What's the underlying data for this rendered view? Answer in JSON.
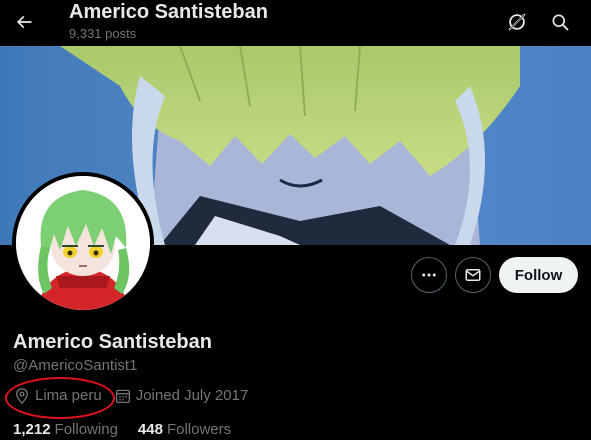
{
  "header": {
    "title": "Americo Santisteban",
    "posts_count": "9,331 posts"
  },
  "actions": {
    "follow_label": "Follow"
  },
  "profile": {
    "display_name": "Americo Santisteban",
    "handle": "@AmericoSantist1",
    "location": "Lima peru",
    "joined": "Joined July 2017"
  },
  "stats": {
    "following_count": "1,212",
    "following_label": "Following",
    "followers_count": "448",
    "followers_label": "Followers"
  },
  "colors": {
    "background": "#000000",
    "text_primary": "#e7e9ea",
    "text_secondary": "#71767b",
    "follow_button_bg": "#eff3f4",
    "annotation_circle": "#e0121b"
  },
  "icons": {
    "back": "arrow-left-icon",
    "grok": "grok-icon",
    "search": "search-icon",
    "more": "more-icon",
    "message": "message-icon",
    "location": "location-pin-icon",
    "calendar": "calendar-icon"
  }
}
